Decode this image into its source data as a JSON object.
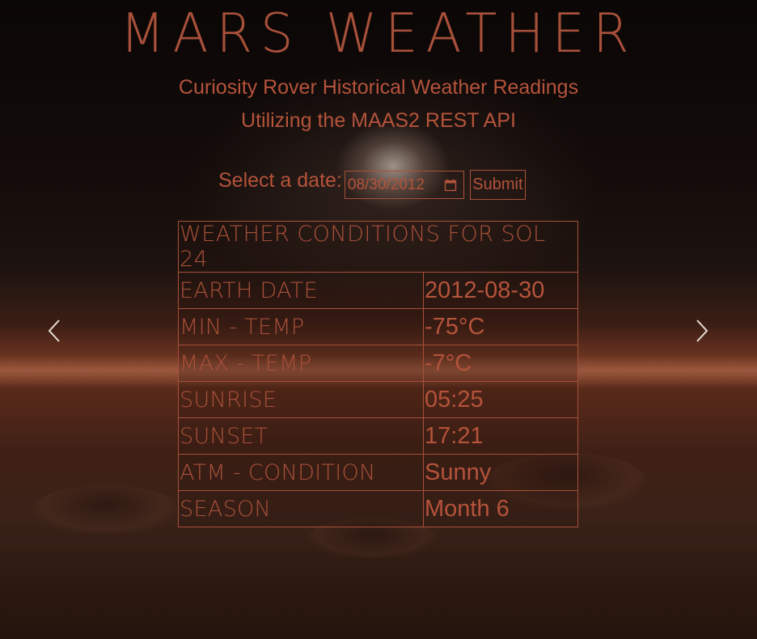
{
  "header": {
    "title": "MARS WEATHER",
    "subtitle_line1": "Curiosity Rover Historical Weather Readings",
    "subtitle_line2": "Utilizing the MAAS2 REST API"
  },
  "form": {
    "label": "Select a date:",
    "date_value": "08/30/2012",
    "submit_label": "Submit"
  },
  "table": {
    "heading": "WEATHER CONDITIONS FOR SOL 24",
    "rows": [
      {
        "key": "EARTH DATE",
        "value": "2012-08-30"
      },
      {
        "key": "MIN - TEMP",
        "value": "-75°C"
      },
      {
        "key": "MAX - TEMP",
        "value": "-7°C"
      },
      {
        "key": "SUNRISE",
        "value": "05:25"
      },
      {
        "key": "SUNSET",
        "value": "17:21"
      },
      {
        "key": "ATM - CONDITION",
        "value": "Sunny"
      },
      {
        "key": "SEASON",
        "value": "Month 6"
      }
    ]
  },
  "icons": {
    "prev": "chevron-left-icon",
    "next": "chevron-right-icon",
    "calendar": "calendar-icon"
  },
  "colors": {
    "accent": "#b5533b",
    "border": "#a8503a"
  }
}
